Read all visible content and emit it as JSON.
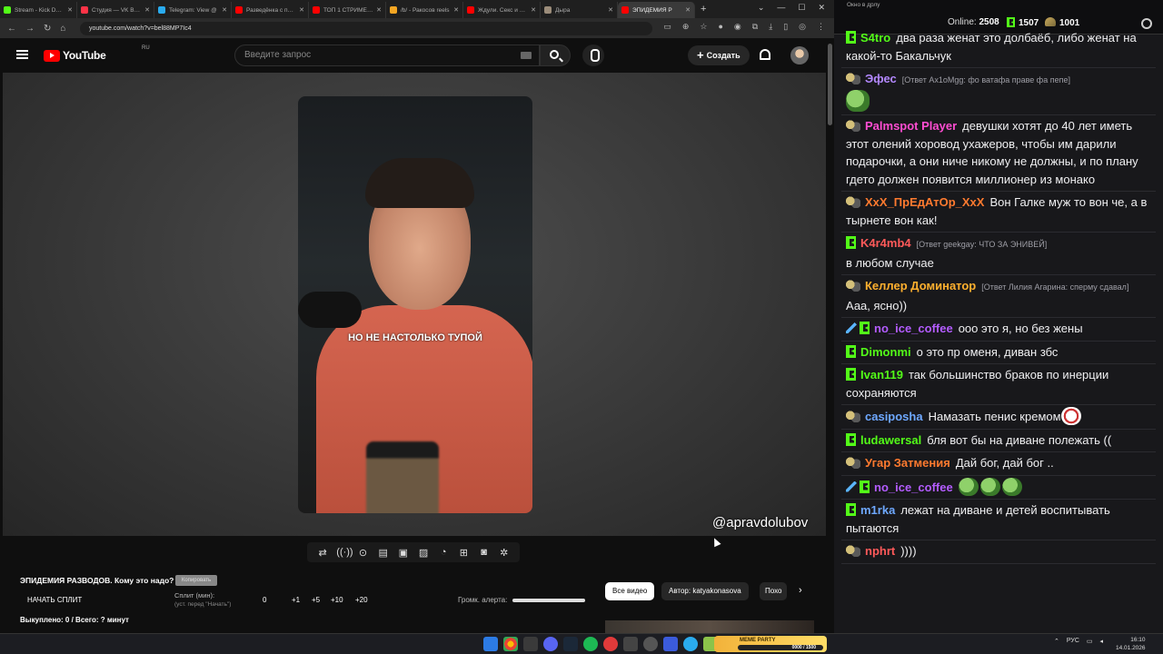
{
  "browser": {
    "tabs": [
      {
        "label": "Stream - Kick Dashboard",
        "color": "#53fc18",
        "active": false
      },
      {
        "label": "Студия — VK Видео",
        "color": "#ff3347",
        "active": false
      },
      {
        "label": "Telegram: View @",
        "color": "#2aabee",
        "active": false
      },
      {
        "label": "Разведёнка с приц",
        "color": "#ff0000",
        "active": false
      },
      {
        "label": "ТОП 1 СТРИМЕР В",
        "color": "#ff0000",
        "active": false
      },
      {
        "label": "/b/ - Ракосов reels",
        "color": "#f5a623",
        "active": false
      },
      {
        "label": "Ждули. Секс и отн",
        "color": "#ff0000",
        "active": false
      },
      {
        "label": "Дыра",
        "color": "#9b8c7a",
        "active": false
      },
      {
        "label": "ЭПИДЕМИЯ Р",
        "color": "#ff0000",
        "active": true
      }
    ],
    "new_tab": "+",
    "url": "youtube.com/watch?v=bel88MP7Ic4"
  },
  "youtube": {
    "logo_text": "YouTube",
    "region": "RU",
    "search_placeholder": "Введите запрос",
    "create_label": "Создать"
  },
  "video": {
    "subtitle": "НО НЕ НАСТОЛЬКО ТУПОЙ",
    "watermark": "@apravdolubov"
  },
  "extension": {
    "toolbar_icons": [
      "loop-icon",
      "broadcast-icon",
      "record-icon",
      "clip-icon",
      "frame-icon",
      "screenshot-icon",
      "speed-icon",
      "add-icon",
      "camera-icon",
      "gear-icon"
    ],
    "video_title": "ЭПИДЕМИЯ РАЗВОДОВ. Кому это надо?",
    "copy_label": "Копировать",
    "start_split": "НАЧАТЬ СПЛИТ",
    "split_label": "Сплит (мин):",
    "split_hint": "(уст. перед \"Начать\")",
    "split_values": [
      "0",
      "+1",
      "+5",
      "+10",
      "+20"
    ],
    "bought": "Выкуплено: 0 / Всего: ? минут",
    "volume_label": "Громк. алерта:",
    "volume_level": 1.0
  },
  "chips": [
    "Все видео",
    "Автор: katyakonasova",
    "Похо"
  ],
  "chat": {
    "window_title": "Окно в дрлу",
    "online_label": "Online:",
    "online": "2508",
    "kick_count": "1507",
    "other_count": "1001",
    "messages": [
      {
        "badge": "kick",
        "user": "S4tro",
        "color": "#53fc18",
        "reply": "",
        "text": "два раза женат это долбаёб, либо женат на какой-то Бакальчук"
      },
      {
        "badge": "crown",
        "user": "Эфес",
        "color": "#b388ff",
        "reply": "[Ответ Ax1oMgg: фо ватафа праве фа пепе]",
        "text": "",
        "emote": "pepe"
      },
      {
        "badge": "crown",
        "user": "Palmspot Player",
        "color": "#ff4dd2",
        "reply": "",
        "text": "девушки хотят до 40 лет иметь этот олений хоровод ухажеров, чтобы им дарили подарочки, а они ниче никому не должны, и по плану гдето должен появится миллионер из монако"
      },
      {
        "badge": "crown",
        "user": "XxX_ПрЕдАтОр_XxX",
        "color": "#ff7a2f",
        "reply": "",
        "text": "Вон Галке муж то вон че, а в тырнете вон как!"
      },
      {
        "badge": "kick",
        "user": "K4r4mb4",
        "color": "#ff5a5a",
        "reply": "[Ответ geekgay: ЧТО ЗА ЭНИВЕЙ]",
        "text": "в любом случае"
      },
      {
        "badge": "crown",
        "user": "Келлер Доминатор",
        "color": "#ffb02e",
        "reply": "[Ответ Лилия Агарина: сперму сдавал]",
        "text": "Ааа, ясно))"
      },
      {
        "badge": "pencil-kick",
        "user": "no_ice_coffee",
        "color": "#b35cff",
        "reply": "",
        "text": "ооо это я, но без жены"
      },
      {
        "badge": "kick",
        "user": "Dimonmi",
        "color": "#53fc18",
        "reply": "",
        "text": "о это пр оменя, диван збс"
      },
      {
        "badge": "kick",
        "user": "Ivan119",
        "color": "#53fc18",
        "reply": "",
        "text": "так большинство браков по инерции сохраняются"
      },
      {
        "badge": "crown",
        "user": "casiposha",
        "color": "#6ea8ff",
        "reply": "",
        "text": "Намазать пенис кремом",
        "emote": "skull"
      },
      {
        "badge": "kick",
        "user": "ludawersal",
        "color": "#53fc18",
        "reply": "",
        "text": "бля вот бы на диване полежать (("
      },
      {
        "badge": "crown",
        "user": "Угар Затмения",
        "color": "#ff7a2f",
        "reply": "",
        "text": "Дай бог, дай бог .."
      },
      {
        "badge": "pencil-kick",
        "user": "no_ice_coffee",
        "color": "#b35cff",
        "reply": "",
        "text": "",
        "emote": "pepe3"
      },
      {
        "badge": "kick",
        "user": "m1rka",
        "color": "#6ea8ff",
        "reply": "",
        "text": "лежат на диване и детей воспитывать пытаются"
      },
      {
        "badge": "crown",
        "user": "nphrt",
        "color": "#ff5a5a",
        "reply": "",
        "text": "))))"
      }
    ]
  },
  "taskbar": {
    "meme_title": "MEME PARTY",
    "meme_progress": "0000 / 1500",
    "lang": "РУС",
    "time": "16:10",
    "date": "14.01.2026"
  }
}
